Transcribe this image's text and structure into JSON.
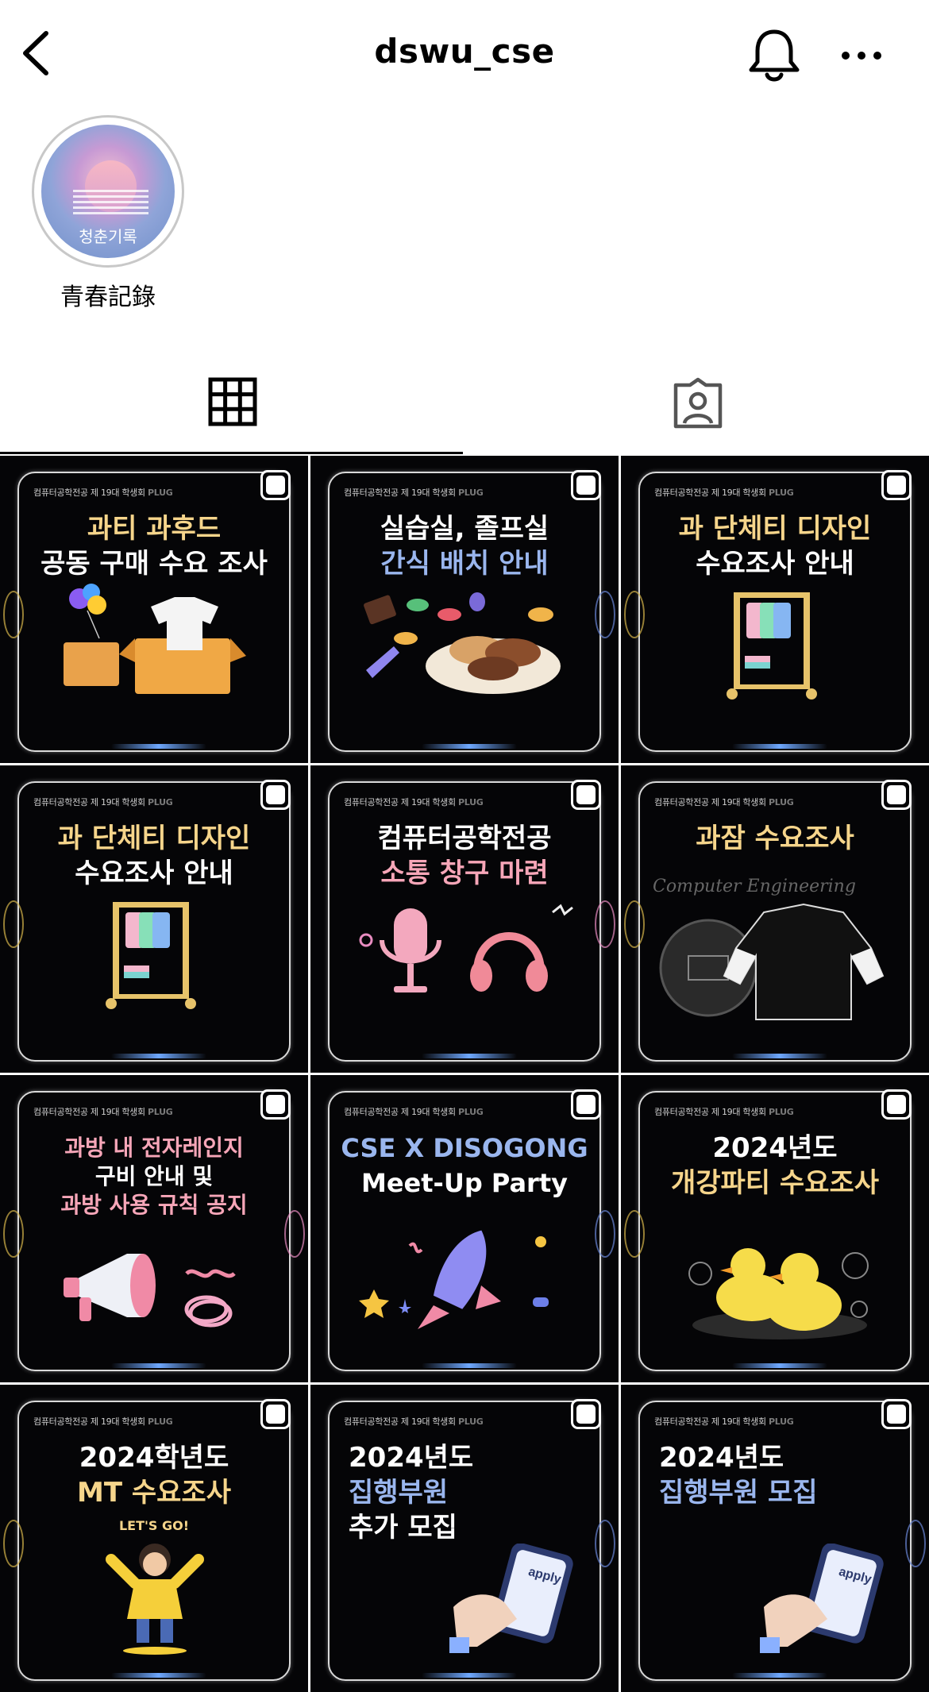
{
  "header": {
    "title": "dswu_cse"
  },
  "highlight": {
    "label": "青春記錄",
    "cover_text": "청춘기록"
  },
  "tabs": [
    {
      "name": "posts-grid"
    },
    {
      "name": "tagged"
    }
  ],
  "posts": {
    "org_line": "컴퓨터공학전공 제 19대 학생회",
    "org_brand": "PLUG",
    "items": [
      {
        "lines": [
          "과티 과후드",
          "공동 구매 수요 조사"
        ]
      },
      {
        "lines": [
          "실습실, 졸프실",
          "간식 배치 안내"
        ]
      },
      {
        "lines": [
          "과 단체티 디자인",
          "수요조사 안내"
        ]
      },
      {
        "lines": [
          "과 단체티 디자인",
          "수요조사 안내"
        ]
      },
      {
        "lines": [
          "컴퓨터공학전공",
          "소통 창구 마련"
        ]
      },
      {
        "lines": [
          "과잠 수요조사"
        ],
        "subtext": "Computer Engineering"
      },
      {
        "lines": [
          "과방 내 전자레인지",
          "구비 안내 및",
          "과방 사용 규칙 공지"
        ]
      },
      {
        "lines": [
          "CSE X DISOGONG",
          "Meet-Up Party"
        ]
      },
      {
        "lines": [
          "2024년도",
          "개강파티 수요조사"
        ]
      },
      {
        "lines": [
          "2024학년도",
          "MT 수요조사"
        ],
        "badge": "LET'S GO!"
      },
      {
        "lines": [
          "2024년도",
          "집행부원",
          "추가 모집"
        ],
        "badge": "apply"
      },
      {
        "lines": [
          "2024년도",
          "집행부원 모집"
        ],
        "badge": "apply"
      }
    ]
  },
  "colors": {
    "accent_yellow": "#f6d58b",
    "accent_blue": "#9ab6ee",
    "accent_pink": "#f7a6b8"
  }
}
